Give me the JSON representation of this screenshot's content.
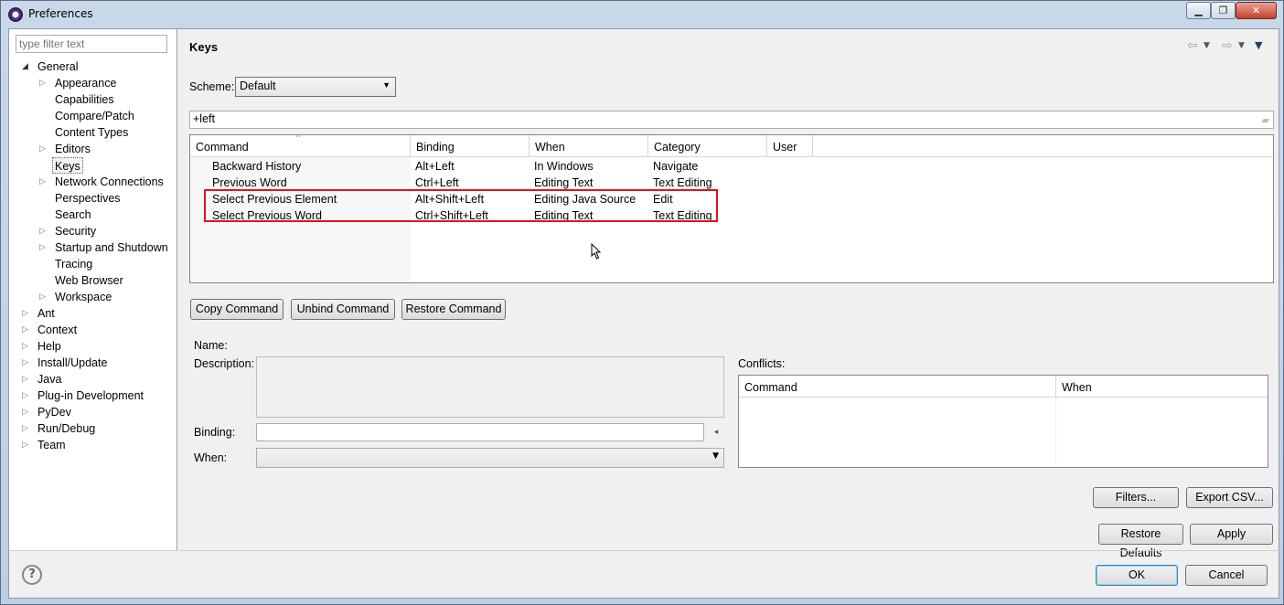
{
  "window": {
    "title": "Preferences",
    "min_glyph": "▁",
    "max_glyph": "❐",
    "close_glyph": "✕"
  },
  "left_pane": {
    "filter_placeholder": "type filter text",
    "tree": [
      {
        "label": "General",
        "level": 0,
        "expanded": true
      },
      {
        "label": "Appearance",
        "level": 1,
        "has_children": true
      },
      {
        "label": "Capabilities",
        "level": 1
      },
      {
        "label": "Compare/Patch",
        "level": 1
      },
      {
        "label": "Content Types",
        "level": 1
      },
      {
        "label": "Editors",
        "level": 1,
        "has_children": true
      },
      {
        "label": "Keys",
        "level": 1,
        "selected": true
      },
      {
        "label": "Network Connections",
        "level": 1,
        "has_children": true
      },
      {
        "label": "Perspectives",
        "level": 1
      },
      {
        "label": "Search",
        "level": 1
      },
      {
        "label": "Security",
        "level": 1,
        "has_children": true
      },
      {
        "label": "Startup and Shutdown",
        "level": 1,
        "has_children": true
      },
      {
        "label": "Tracing",
        "level": 1
      },
      {
        "label": "Web Browser",
        "level": 1
      },
      {
        "label": "Workspace",
        "level": 1,
        "has_children": true
      },
      {
        "label": "Ant",
        "level": 0,
        "has_children": true
      },
      {
        "label": "Context",
        "level": 0,
        "has_children": true
      },
      {
        "label": "Help",
        "level": 0,
        "has_children": true
      },
      {
        "label": "Install/Update",
        "level": 0,
        "has_children": true
      },
      {
        "label": "Java",
        "level": 0,
        "has_children": true
      },
      {
        "label": "Plug-in Development",
        "level": 0,
        "has_children": true
      },
      {
        "label": "PyDev",
        "level": 0,
        "has_children": true
      },
      {
        "label": "Run/Debug",
        "level": 0,
        "has_children": true
      },
      {
        "label": "Team",
        "level": 0,
        "has_children": true
      }
    ]
  },
  "page": {
    "title": "Keys",
    "scheme_label": "Scheme:",
    "scheme_value": "Default",
    "search_value": "+left",
    "table": {
      "columns": [
        "Command",
        "Binding",
        "When",
        "Category",
        "User"
      ],
      "rows": [
        [
          "Backward History",
          "Alt+Left",
          "In Windows",
          "Navigate",
          ""
        ],
        [
          "Previous Word",
          "Ctrl+Left",
          "Editing Text",
          "Text Editing",
          ""
        ],
        [
          "Select Previous Element",
          "Alt+Shift+Left",
          "Editing Java Source",
          "Edit",
          ""
        ],
        [
          "Select Previous Word",
          "Ctrl+Shift+Left",
          "Editing Text",
          "Text Editing",
          ""
        ]
      ]
    },
    "buttons": {
      "copy": "Copy Command",
      "unbind": "Unbind Command",
      "restore": "Restore Command"
    },
    "details": {
      "name_label": "Name:",
      "description_label": "Description:",
      "binding_label": "Binding:",
      "when_label": "When:"
    },
    "conflicts": {
      "label": "Conflicts:",
      "columns": [
        "Command",
        "When"
      ]
    },
    "filters_button": "Filters...",
    "export_button": "Export CSV...",
    "restore_defaults_button": "Restore Defaults",
    "apply_button": "Apply"
  },
  "footer": {
    "help_glyph": "?",
    "ok_button": "OK",
    "cancel_button": "Cancel"
  },
  "colors": {
    "highlight_box": "#e0141e",
    "titlebar": "#c9d8e9",
    "close_button": "#c3412a"
  }
}
